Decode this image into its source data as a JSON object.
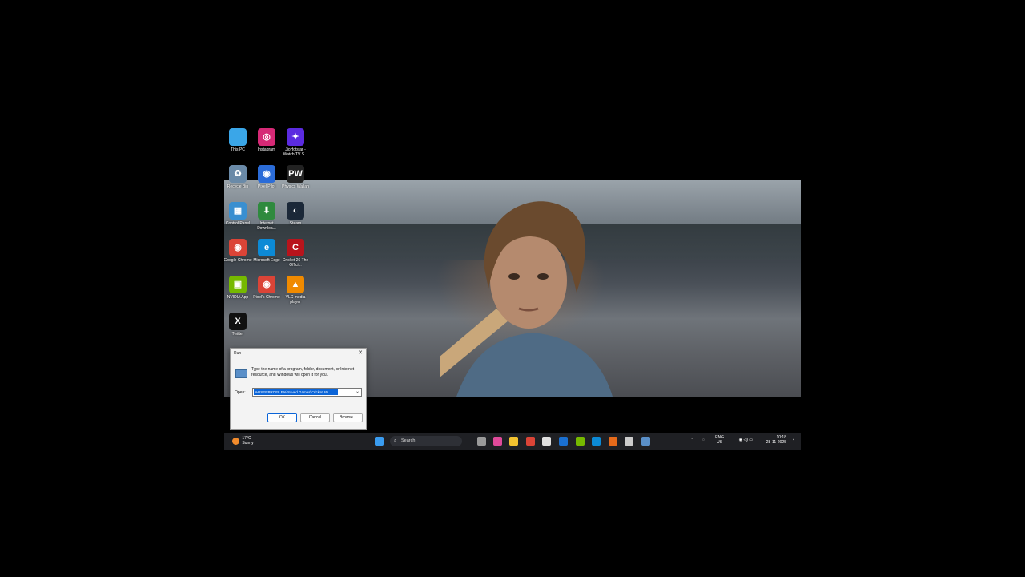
{
  "desktop_icons": [
    {
      "label": "This PC",
      "icon": "monitor-icon",
      "color": "#3aa6e8",
      "glyph": ""
    },
    {
      "label": "Instagram",
      "icon": "instagram-icon",
      "color": "#d62976",
      "glyph": "◎"
    },
    {
      "label": "JioHotstar - Watch TV S...",
      "icon": "jiohotstar-icon",
      "color": "#5b2be0",
      "glyph": "✦"
    },
    {
      "label": "Recycle Bin",
      "icon": "recycle-bin-icon",
      "color": "#6a8aa8",
      "glyph": "♻"
    },
    {
      "label": "Pixel Pilot",
      "icon": "app-icon",
      "color": "#2b6cd8",
      "glyph": "◉"
    },
    {
      "label": "Physics Wallah",
      "icon": "physics-wallah-icon",
      "color": "#222222",
      "glyph": "PW"
    },
    {
      "label": "Control Panel",
      "icon": "control-panel-icon",
      "color": "#3a8fd0",
      "glyph": "▦"
    },
    {
      "label": "Internet Downloa...",
      "icon": "idm-icon",
      "color": "#2f8a3e",
      "glyph": "⬇"
    },
    {
      "label": "Steam",
      "icon": "steam-icon",
      "color": "#1b2838",
      "glyph": "◐"
    },
    {
      "label": "Google Chrome",
      "icon": "chrome-icon",
      "color": "#db4437",
      "glyph": "◉"
    },
    {
      "label": "Microsoft Edge",
      "icon": "edge-icon",
      "color": "#0c8ad6",
      "glyph": "e"
    },
    {
      "label": "Cricket 26 The Offici...",
      "icon": "cricket-game-icon",
      "color": "#b8141c",
      "glyph": "C"
    },
    {
      "label": "NVIDIA App",
      "icon": "nvidia-icon",
      "color": "#76b900",
      "glyph": "▣"
    },
    {
      "label": "Pixel's Chrome",
      "icon": "chrome-icon",
      "color": "#db4437",
      "glyph": "◉"
    },
    {
      "label": "VLC media player",
      "icon": "vlc-icon",
      "color": "#f08a00",
      "glyph": "▲"
    },
    {
      "label": "Twitter",
      "icon": "x-icon",
      "color": "#111111",
      "glyph": "X"
    }
  ],
  "run_dialog": {
    "title": "Run",
    "close": "✕",
    "description": "Type the name of a program, folder, document, or Internet resource, and Windows will open it for you.",
    "open_label": "Open:",
    "open_value": "%USERPROFILE%\\Saved Games\\Cricket 26",
    "ok": "OK",
    "cancel": "Cancel",
    "browse": "Browse..."
  },
  "taskbar": {
    "weather_temp": "17°C",
    "weather_desc": "Sunny",
    "search_placeholder": "Search",
    "search_icon": "⌕",
    "tray_up_arrow": "^",
    "lang_top": "ENG",
    "lang_bottom": "US",
    "tray_icons": "◉ ◁) ▭",
    "time": "10:18",
    "date": "28-11-2025",
    "apps": [
      {
        "icon": "windows-start-icon",
        "color": "#3a9cf0"
      },
      {
        "icon": "task-view-icon",
        "color": "#9a9a9a"
      },
      {
        "icon": "copilot-icon",
        "color": "#e04a9a"
      },
      {
        "icon": "file-explorer-icon",
        "color": "#f2c230"
      },
      {
        "icon": "chrome-icon",
        "color": "#db4437"
      },
      {
        "icon": "store-icon",
        "color": "#e0e0e0"
      },
      {
        "icon": "outlook-icon",
        "color": "#1a6fd0"
      },
      {
        "icon": "nvidia-icon",
        "color": "#76b900"
      },
      {
        "icon": "edge-icon",
        "color": "#0c8ad6"
      },
      {
        "icon": "firefox-icon",
        "color": "#e66a1a"
      },
      {
        "icon": "notepad-icon",
        "color": "#cccccc"
      },
      {
        "icon": "run-icon",
        "color": "#5a8fc8"
      }
    ]
  }
}
